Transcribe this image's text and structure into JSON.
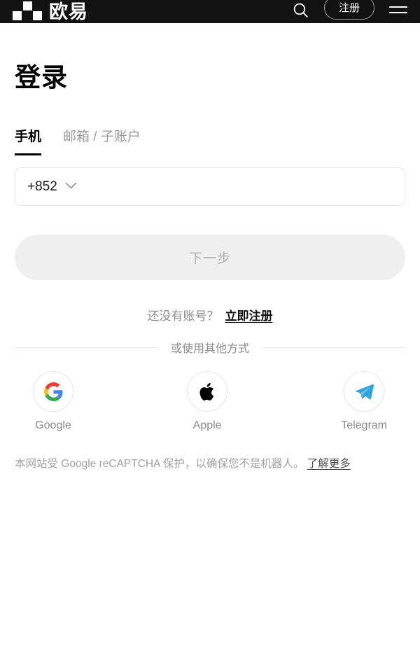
{
  "header": {
    "logo_text": "欧易",
    "logo_mark_icon": "okx-logo-mark",
    "search_icon": "search-icon",
    "register_label": "注册",
    "menu_icon": "hamburger-menu-icon",
    "background_color": "#121212"
  },
  "main": {
    "title": "登录",
    "tabs": [
      {
        "label": "手机",
        "active": true
      },
      {
        "label": "邮箱 / 子账户",
        "active": false
      }
    ],
    "phone_field": {
      "country_code": "+852",
      "chevron_icon": "chevron-down-icon",
      "phone_placeholder": ""
    },
    "submit": {
      "label": "下一步",
      "disabled": true,
      "background_color": "#efefef",
      "text_color": "#b0b0b0"
    },
    "register_prompt": {
      "text": "还没有账号？",
      "link_label": "立即注册"
    },
    "divider_label": "或使用其他方式",
    "socials": [
      {
        "name": "Google",
        "icon": "google-icon",
        "color": "#4285F4"
      },
      {
        "name": "Apple",
        "icon": "apple-icon",
        "color": "#000000"
      },
      {
        "name": "Telegram",
        "icon": "telegram-icon",
        "color": "#2EA6DC"
      }
    ],
    "recaptcha": {
      "text": "本网站受 Google reCAPTCHA 保护，以确保您不是机器人。",
      "link_label": "了解更多"
    }
  }
}
